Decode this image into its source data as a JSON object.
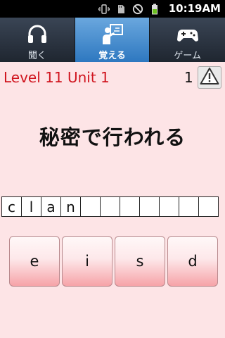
{
  "status_bar": {
    "time": "10:19AM",
    "icons": [
      "vibrate-icon",
      "sd-card-icon",
      "no-signal-icon",
      "battery-icon"
    ]
  },
  "tabs": [
    {
      "label": "聞く",
      "icon": "headphones-icon",
      "active": false
    },
    {
      "label": "覚える",
      "icon": "teacher-icon",
      "active": true
    },
    {
      "label": "ゲーム",
      "icon": "gamepad-icon",
      "active": false
    }
  ],
  "header": {
    "level_text": "Level 11 Unit 1",
    "counter": "1",
    "warn_icon": "warning-icon"
  },
  "question": {
    "word": "秘密で行われる"
  },
  "answer_slots": [
    "c",
    "l",
    "a",
    "n",
    "",
    "",
    "",
    "",
    "",
    "",
    ""
  ],
  "choices": [
    "e",
    "i",
    "s",
    "d"
  ],
  "colors": {
    "level_text": "#d0141e",
    "background": "#fde4e6",
    "active_tab": "#2e78c0"
  }
}
